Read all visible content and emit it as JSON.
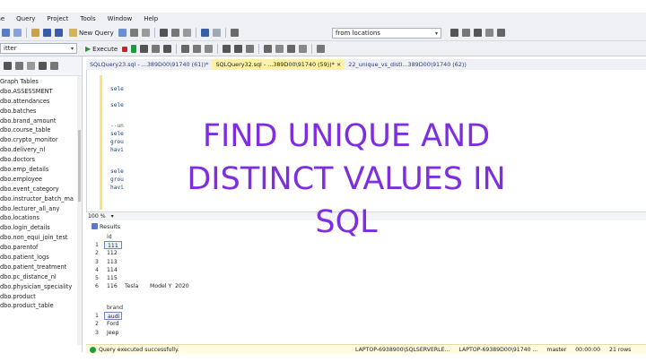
{
  "menu": [
    "me",
    "Query",
    "Project",
    "Tools",
    "Window",
    "Help"
  ],
  "toolbar1": {
    "new_query_label": "New Query",
    "database_combo": "from locations"
  },
  "toolbar2": {
    "db_combo": "itter",
    "execute_label": "Execute"
  },
  "object_explorer": {
    "items": [
      "Graph Tables",
      "dbo.ASSESSMENT",
      "dbo.attendances",
      "dbo.batches",
      "dbo.brand_amount",
      "dbo.course_table",
      "dbo.crypto_monitor",
      "dbo.delivery_nl",
      "dbo.doctors",
      "dbo.emp_details",
      "dbo.employee",
      "dbo.event_category",
      "dbo.instructor_batch_ma",
      "dbo.lecturer_all_any",
      "dbo.locations",
      "dbo.login_details",
      "dbo.non_equi_join_test",
      "dbo.parentof",
      "dbo.patient_logs",
      "dbo.patient_treatment",
      "dbo.pc_distance_nl",
      "dbo.physician_speciality",
      "dbo.product",
      "dbo.product_table"
    ]
  },
  "tabs": [
    {
      "label": "SQLQuery23.sql - ...389D00\\91740 (61))*"
    },
    {
      "label": "SQLQuery32.sql - ...389D00\\91740 (59))*  ×"
    },
    {
      "label": "22_unique_vs_disti...389D00\\91740 (62))"
    }
  ],
  "editor": {
    "lines": [
      "sele",
      "sele",
      "--un",
      "sele",
      "grou",
      "havi",
      "sele",
      "grou",
      "havi"
    ]
  },
  "zoom": "100 %",
  "results_tab": "Results",
  "grid1": {
    "header": "id",
    "rows": [
      {
        "n": "1",
        "id": "111"
      },
      {
        "n": "2",
        "id": "112"
      },
      {
        "n": "3",
        "id": "113"
      },
      {
        "n": "4",
        "id": "114"
      },
      {
        "n": "5",
        "id": "115"
      },
      {
        "n": "6",
        "id": "116",
        "brand": "Tesla",
        "model": "Model Y",
        "year": "2020"
      }
    ]
  },
  "grid2": {
    "header": "brand",
    "rows": [
      {
        "n": "1",
        "v": "audi"
      },
      {
        "n": "2",
        "v": "Ford"
      },
      {
        "n": "3",
        "v": "Jeep"
      }
    ]
  },
  "status": {
    "message": "Query executed successfully.",
    "server": "LAPTOP-6938900\\SQLSERVERLE...",
    "user": "LAPTOP-69389D00\\91740 ...",
    "db": "master",
    "time": "00:00:00",
    "rows": "21 rows"
  },
  "overlay": {
    "line1": "FIND UNIQUE AND",
    "line2": "DISTINCT VALUES IN",
    "line3": "SQL"
  },
  "colors": {
    "accent_title": "#7d2fe0",
    "active_tab": "#fff1a8",
    "status_bg": "#fffbe0"
  }
}
